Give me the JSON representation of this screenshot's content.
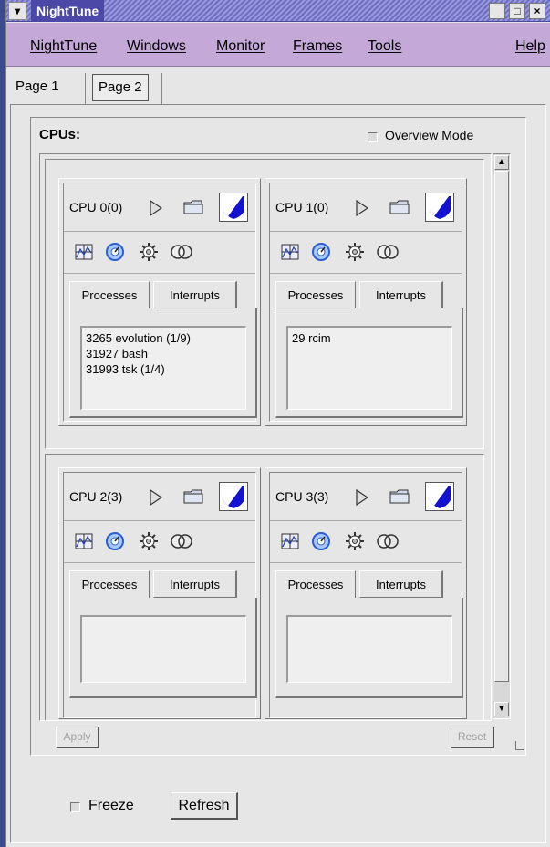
{
  "window": {
    "title": "NightTune",
    "menu_glyph": "▾",
    "min_glyph": "_",
    "max_glyph": "□",
    "close_glyph": "×"
  },
  "menubar": {
    "items": [
      "NightTune",
      "Windows",
      "Monitor",
      "Frames",
      "Tools"
    ],
    "help": "Help"
  },
  "tabs": [
    "Page 1",
    "Page 2"
  ],
  "cpus_panel": {
    "title": "CPUs:",
    "overview_mode": "Overview Mode",
    "overview_mode_checked": false,
    "apply": "Apply",
    "reset": "Reset"
  },
  "cpus": [
    {
      "name": "CPU 0(0)",
      "tabs": [
        "Processes",
        "Interrupts"
      ],
      "active_tab": "Processes",
      "items": [
        "3265 evolution (1/9)",
        "31927 bash",
        "31993 tsk (1/4)"
      ]
    },
    {
      "name": "CPU 1(0)",
      "tabs": [
        "Processes",
        "Interrupts"
      ],
      "active_tab": "Interrupts",
      "items": [
        "29  rcim"
      ]
    },
    {
      "name": "CPU 2(3)",
      "tabs": [
        "Processes",
        "Interrupts"
      ],
      "active_tab": "Processes",
      "items": []
    },
    {
      "name": "CPU 3(3)",
      "tabs": [
        "Processes",
        "Interrupts"
      ],
      "active_tab": "Processes",
      "items": []
    }
  ],
  "footer": {
    "freeze": "Freeze",
    "freeze_checked": false,
    "refresh": "Refresh"
  },
  "colors": {
    "titlebar": "#4b48a8",
    "menubar": "#c4a8d8",
    "window_bg": "#e6e6e6",
    "shield_blue": "#1212d0"
  }
}
